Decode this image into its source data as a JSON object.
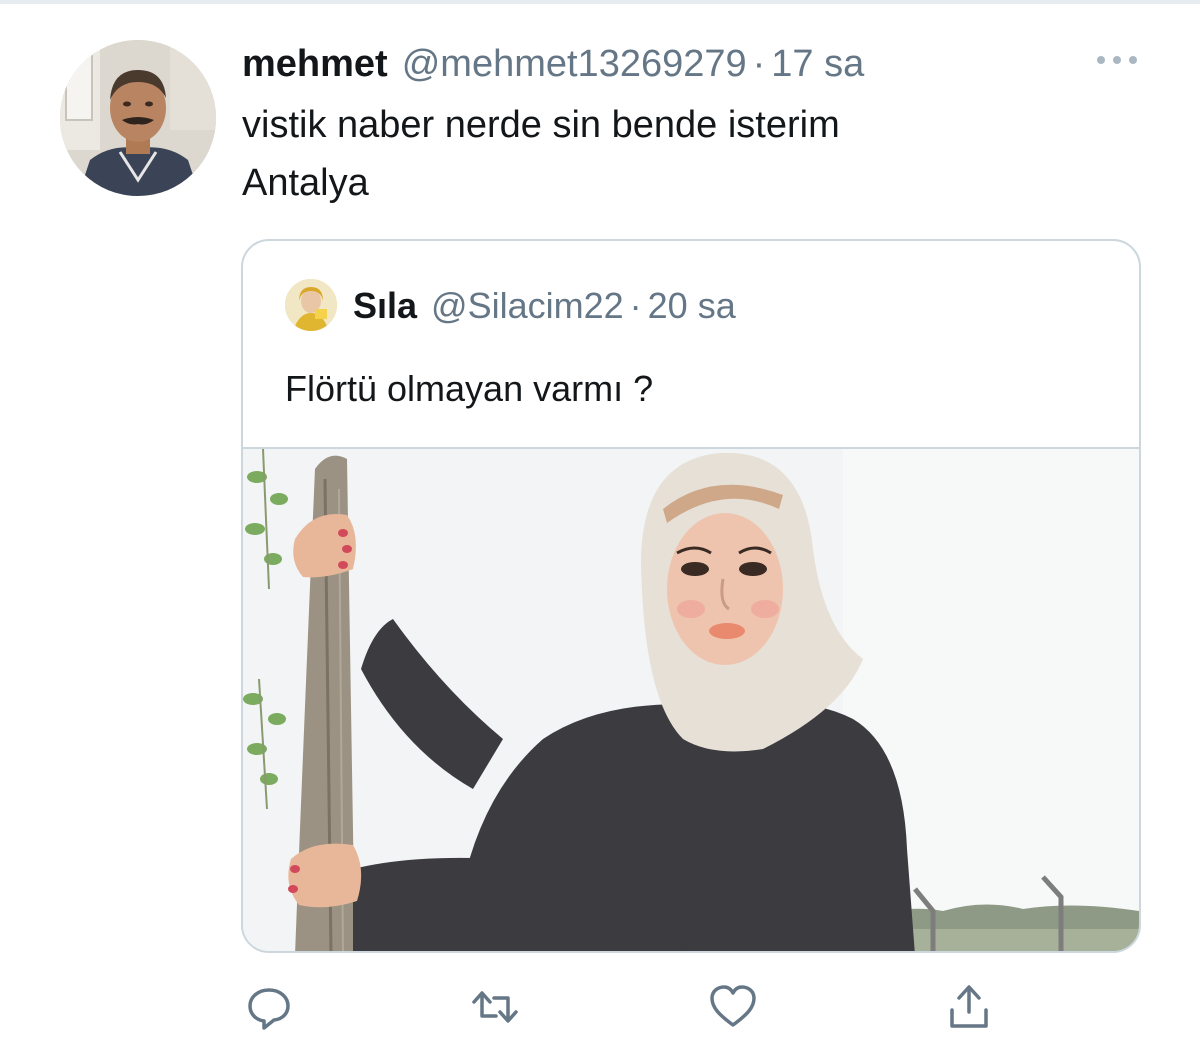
{
  "tweet": {
    "display_name": "mehmet",
    "handle": "@mehmet13269279",
    "separator": "·",
    "time": "17 sa",
    "text_lines": [
      "vistik naber nerde sin bende isterim",
      "Antalya"
    ],
    "avatar_icon": "user-avatar-photo",
    "more_icon": "more-dots-icon"
  },
  "quoted_tweet": {
    "display_name": "Sıla",
    "handle": "@Silacim22",
    "separator": "·",
    "time": "20 sa",
    "text": "Flörtü olmayan varmı ?",
    "avatar_icon": "user-avatar-photo",
    "media": "photo"
  },
  "actions": {
    "reply_icon": "reply-icon",
    "retweet_icon": "retweet-icon",
    "like_icon": "heart-icon",
    "share_icon": "share-icon"
  },
  "colors": {
    "text": "#14171a",
    "secondary": "#657786",
    "border": "#ccd6dd",
    "icon": "#657786"
  }
}
